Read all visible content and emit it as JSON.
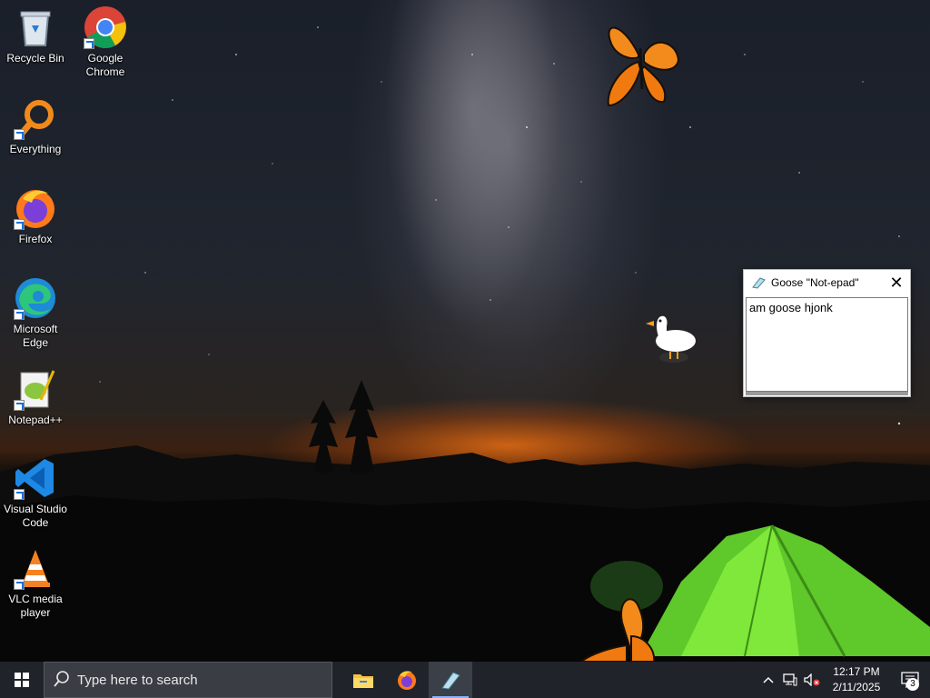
{
  "desktop": {
    "icons": [
      {
        "label": "Recycle Bin",
        "icon": "recycle-bin-icon"
      },
      {
        "label": "Google Chrome",
        "icon": "chrome-icon"
      },
      {
        "label": "Everything",
        "icon": "everything-search-icon"
      },
      {
        "label": "Firefox",
        "icon": "firefox-icon"
      },
      {
        "label": "Microsoft Edge",
        "icon": "edge-icon"
      },
      {
        "label": "Notepad++",
        "icon": "notepadpp-icon"
      },
      {
        "label": "Visual Studio Code",
        "icon": "vscode-icon"
      },
      {
        "label": "VLC media player",
        "icon": "vlc-icon"
      }
    ]
  },
  "goose_window": {
    "title": "Goose \"Not-epad\"",
    "text": "am goose hjonk",
    "close_label": "✕"
  },
  "taskbar": {
    "search_placeholder": "Type here to search",
    "pinned": [
      {
        "name": "file-explorer",
        "icon": "folder-icon"
      },
      {
        "name": "firefox",
        "icon": "firefox-icon"
      },
      {
        "name": "notepad",
        "icon": "notepad-icon",
        "active": true
      }
    ],
    "clock_time": "12:17 PM",
    "clock_date": "2/11/2025",
    "notification_count": "3"
  },
  "colors": {
    "taskbar_bg": "#20232a",
    "search_bg": "#3a3d44",
    "accent": "#8ab4f8"
  }
}
